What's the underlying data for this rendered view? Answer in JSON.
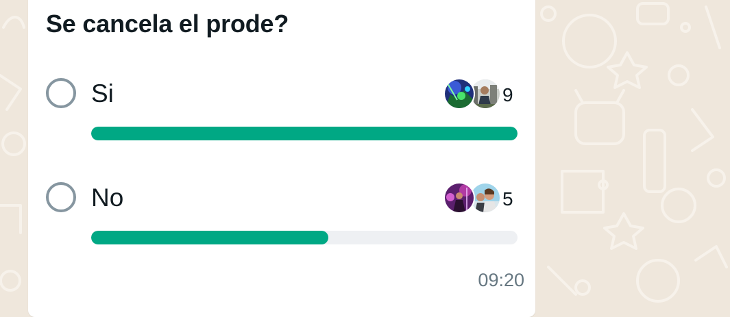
{
  "poll": {
    "question": "Se cancela el prode?",
    "options": [
      {
        "label": "Si",
        "votes": "9",
        "fraction": 1.0,
        "voter_avatars": [
          "avatar-green-lights",
          "avatar-outdoor-person"
        ]
      },
      {
        "label": "No",
        "votes": "5",
        "fraction": 0.5556,
        "voter_avatars": [
          "avatar-purple-stage",
          "avatar-couple-photo"
        ]
      }
    ],
    "timestamp": "09:20"
  },
  "colors": {
    "bar_fill": "#00a884",
    "bar_track": "#eef0f3",
    "radio_border": "#8696a0",
    "chat_background": "#efe7dc",
    "bubble": "#ffffff",
    "text_primary": "#111b21",
    "text_secondary": "#667781"
  }
}
